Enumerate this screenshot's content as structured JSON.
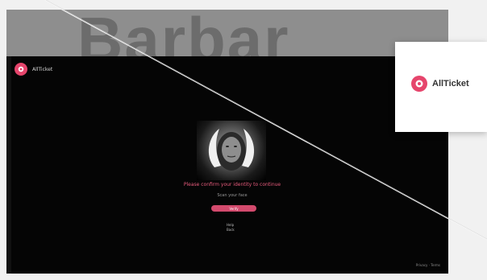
{
  "page": {
    "top_title": "Barbar",
    "brand": "AllTicket"
  },
  "hero": {
    "caption": "Please confirm your identity to continue",
    "subcaption": "Scan your face",
    "cta_label": "Verify",
    "menu_items": [
      "Help",
      "Back"
    ],
    "footer": "Privacy · Terms"
  },
  "popup": {
    "brand": "AllTicket"
  },
  "colors": {
    "accent": "#e6456c",
    "hero_bg": "#050505",
    "top_band": "#8e8e8e"
  }
}
